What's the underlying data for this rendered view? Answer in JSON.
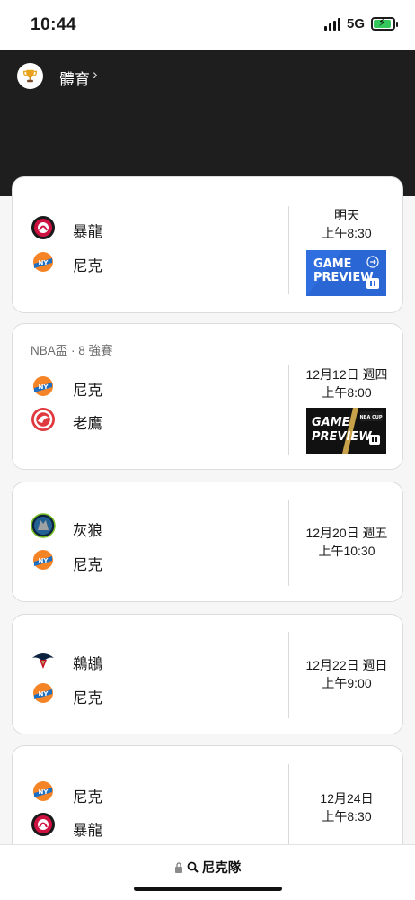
{
  "status_bar": {
    "time": "10:44",
    "network": "5G"
  },
  "header": {
    "title": "體育",
    "chevron": "›"
  },
  "games": [
    {
      "stage": "",
      "teams": [
        {
          "name": "暴龍",
          "logo": "raptors-logo"
        },
        {
          "name": "尼克",
          "logo": "knicks-logo"
        }
      ],
      "date_line1": "明天",
      "date_line2": "上午8:30",
      "preview": {
        "line1": "GAME",
        "line2": "PREVIEW",
        "style": "blue"
      }
    },
    {
      "stage": "NBA盃 · 8 強賽",
      "teams": [
        {
          "name": "尼克",
          "logo": "knicks-logo"
        },
        {
          "name": "老鷹",
          "logo": "hawks-logo"
        }
      ],
      "date_line1": "12月12日 週四",
      "date_line2": "上午8:00",
      "preview": {
        "line1": "GAME",
        "line2": "PREVIEW",
        "badge": "NBA CUP",
        "style": "dark"
      }
    },
    {
      "stage": "",
      "teams": [
        {
          "name": "灰狼",
          "logo": "timberwolves-logo"
        },
        {
          "name": "尼克",
          "logo": "knicks-logo"
        }
      ],
      "date_line1": "12月20日 週五",
      "date_line2": "上午10:30"
    },
    {
      "stage": "",
      "teams": [
        {
          "name": "鵜鶘",
          "logo": "pelicans-logo"
        },
        {
          "name": "尼克",
          "logo": "knicks-logo"
        }
      ],
      "date_line1": "12月22日 週日",
      "date_line2": "上午9:00"
    },
    {
      "stage": "",
      "teams": [
        {
          "name": "尼克",
          "logo": "knicks-logo"
        },
        {
          "name": "暴龍",
          "logo": "raptors-logo"
        }
      ],
      "date_line1": "12月24日",
      "date_line2": "上午8:30"
    }
  ],
  "bottom_bar": {
    "search_text": "尼克隊"
  },
  "colors": {
    "header_bg": "#1e1e1e",
    "preview_blue": "#2f6fe0",
    "knicks_blue": "#1d6fc4",
    "knicks_orange": "#f58426",
    "raptors_red": "#ce1141"
  }
}
